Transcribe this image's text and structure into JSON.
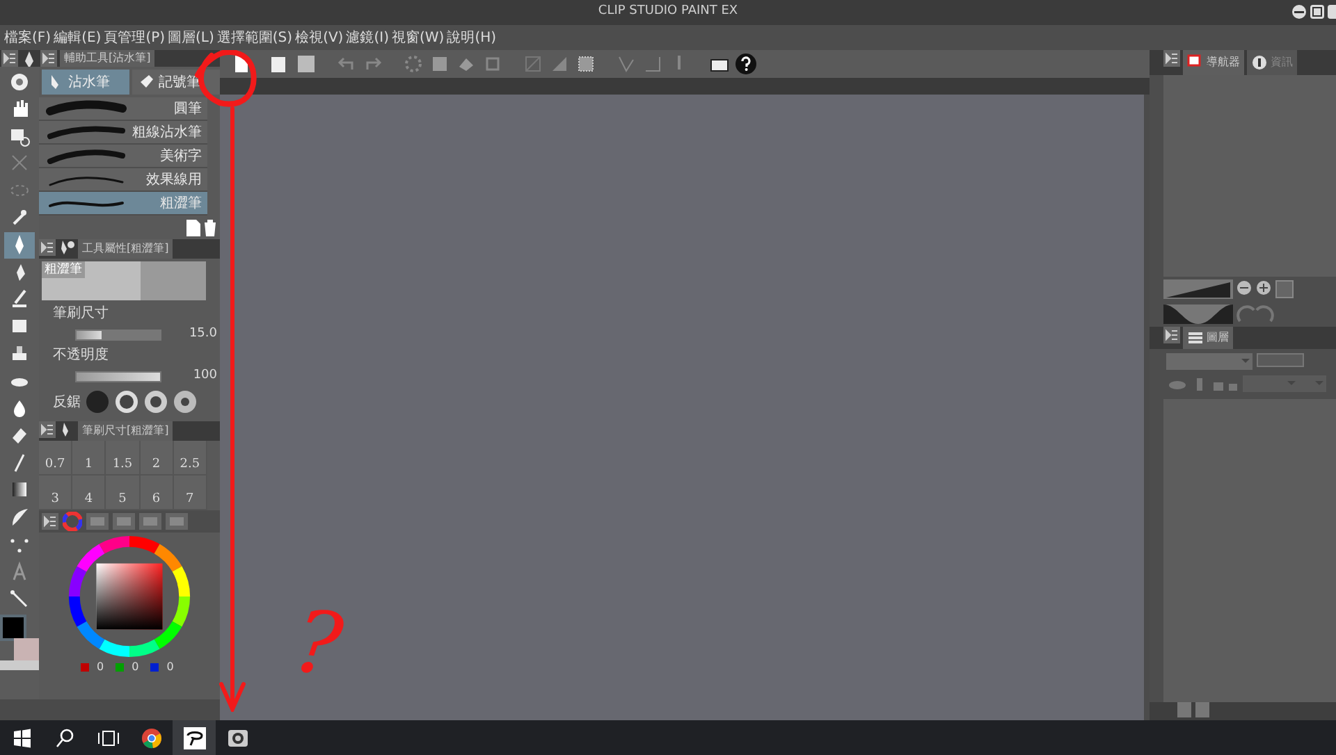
{
  "window": {
    "title": "CLIP STUDIO PAINT EX"
  },
  "menu": [
    "檔案(F)",
    "編輯(E)",
    "頁管理(P)",
    "圖層(L)",
    "選擇範圍(S)",
    "檢視(V)",
    "濾鏡(I)",
    "視窗(W)",
    "說明(H)"
  ],
  "tools": [
    {
      "selected": false
    },
    {
      "selected": false
    },
    {
      "selected": false
    },
    {
      "selected": false
    },
    {
      "selected": false
    },
    {
      "selected": false
    },
    {
      "selected": true
    },
    {
      "selected": false
    },
    {
      "selected": false
    },
    {
      "selected": false
    },
    {
      "selected": false
    },
    {
      "selected": false
    },
    {
      "selected": false
    },
    {
      "selected": false
    },
    {
      "selected": false
    },
    {
      "selected": false
    },
    {
      "selected": false
    },
    {
      "selected": false
    },
    {
      "selected": false
    },
    {
      "selected": false
    }
  ],
  "sub_tool": {
    "tab": "輔助工具[沾水筆]",
    "groups": [
      {
        "label": "沾水筆",
        "selected": true
      },
      {
        "label": "記號筆",
        "selected": false
      }
    ],
    "brushes": [
      {
        "name": "圓筆",
        "selected": false
      },
      {
        "name": "粗線沾水筆",
        "selected": false
      },
      {
        "name": "美術字",
        "selected": false
      },
      {
        "name": "效果線用",
        "selected": false
      },
      {
        "name": "粗澀筆",
        "selected": true
      }
    ]
  },
  "tool_property": {
    "tab": "工具屬性[粗澀筆]",
    "preview_label": "粗澀筆",
    "rows": [
      {
        "label": "筆刷尺寸",
        "value": "15.0",
        "level": 0.3
      },
      {
        "label": "不透明度",
        "value": "100",
        "level": 1
      }
    ],
    "anti_alias_label": "反鋸"
  },
  "brush_size": {
    "tab": "筆刷尺寸[粗澀筆]",
    "sizes": [
      "0.7",
      "1",
      "1.5",
      "2",
      "2.5",
      "3",
      "4",
      "5",
      "6",
      "7"
    ]
  },
  "color": {
    "readings": [
      {
        "color": "#c00000",
        "value": "0"
      },
      {
        "color": "#00a000",
        "value": "0"
      },
      {
        "color": "#0020d0",
        "value": "0"
      }
    ]
  },
  "navigator": {
    "tabs": [
      {
        "label": "導航器",
        "selected": true
      },
      {
        "label": "資訊",
        "selected": false
      }
    ]
  },
  "layer": {
    "tab": "圖層"
  },
  "annotation": {
    "mark": "?"
  }
}
